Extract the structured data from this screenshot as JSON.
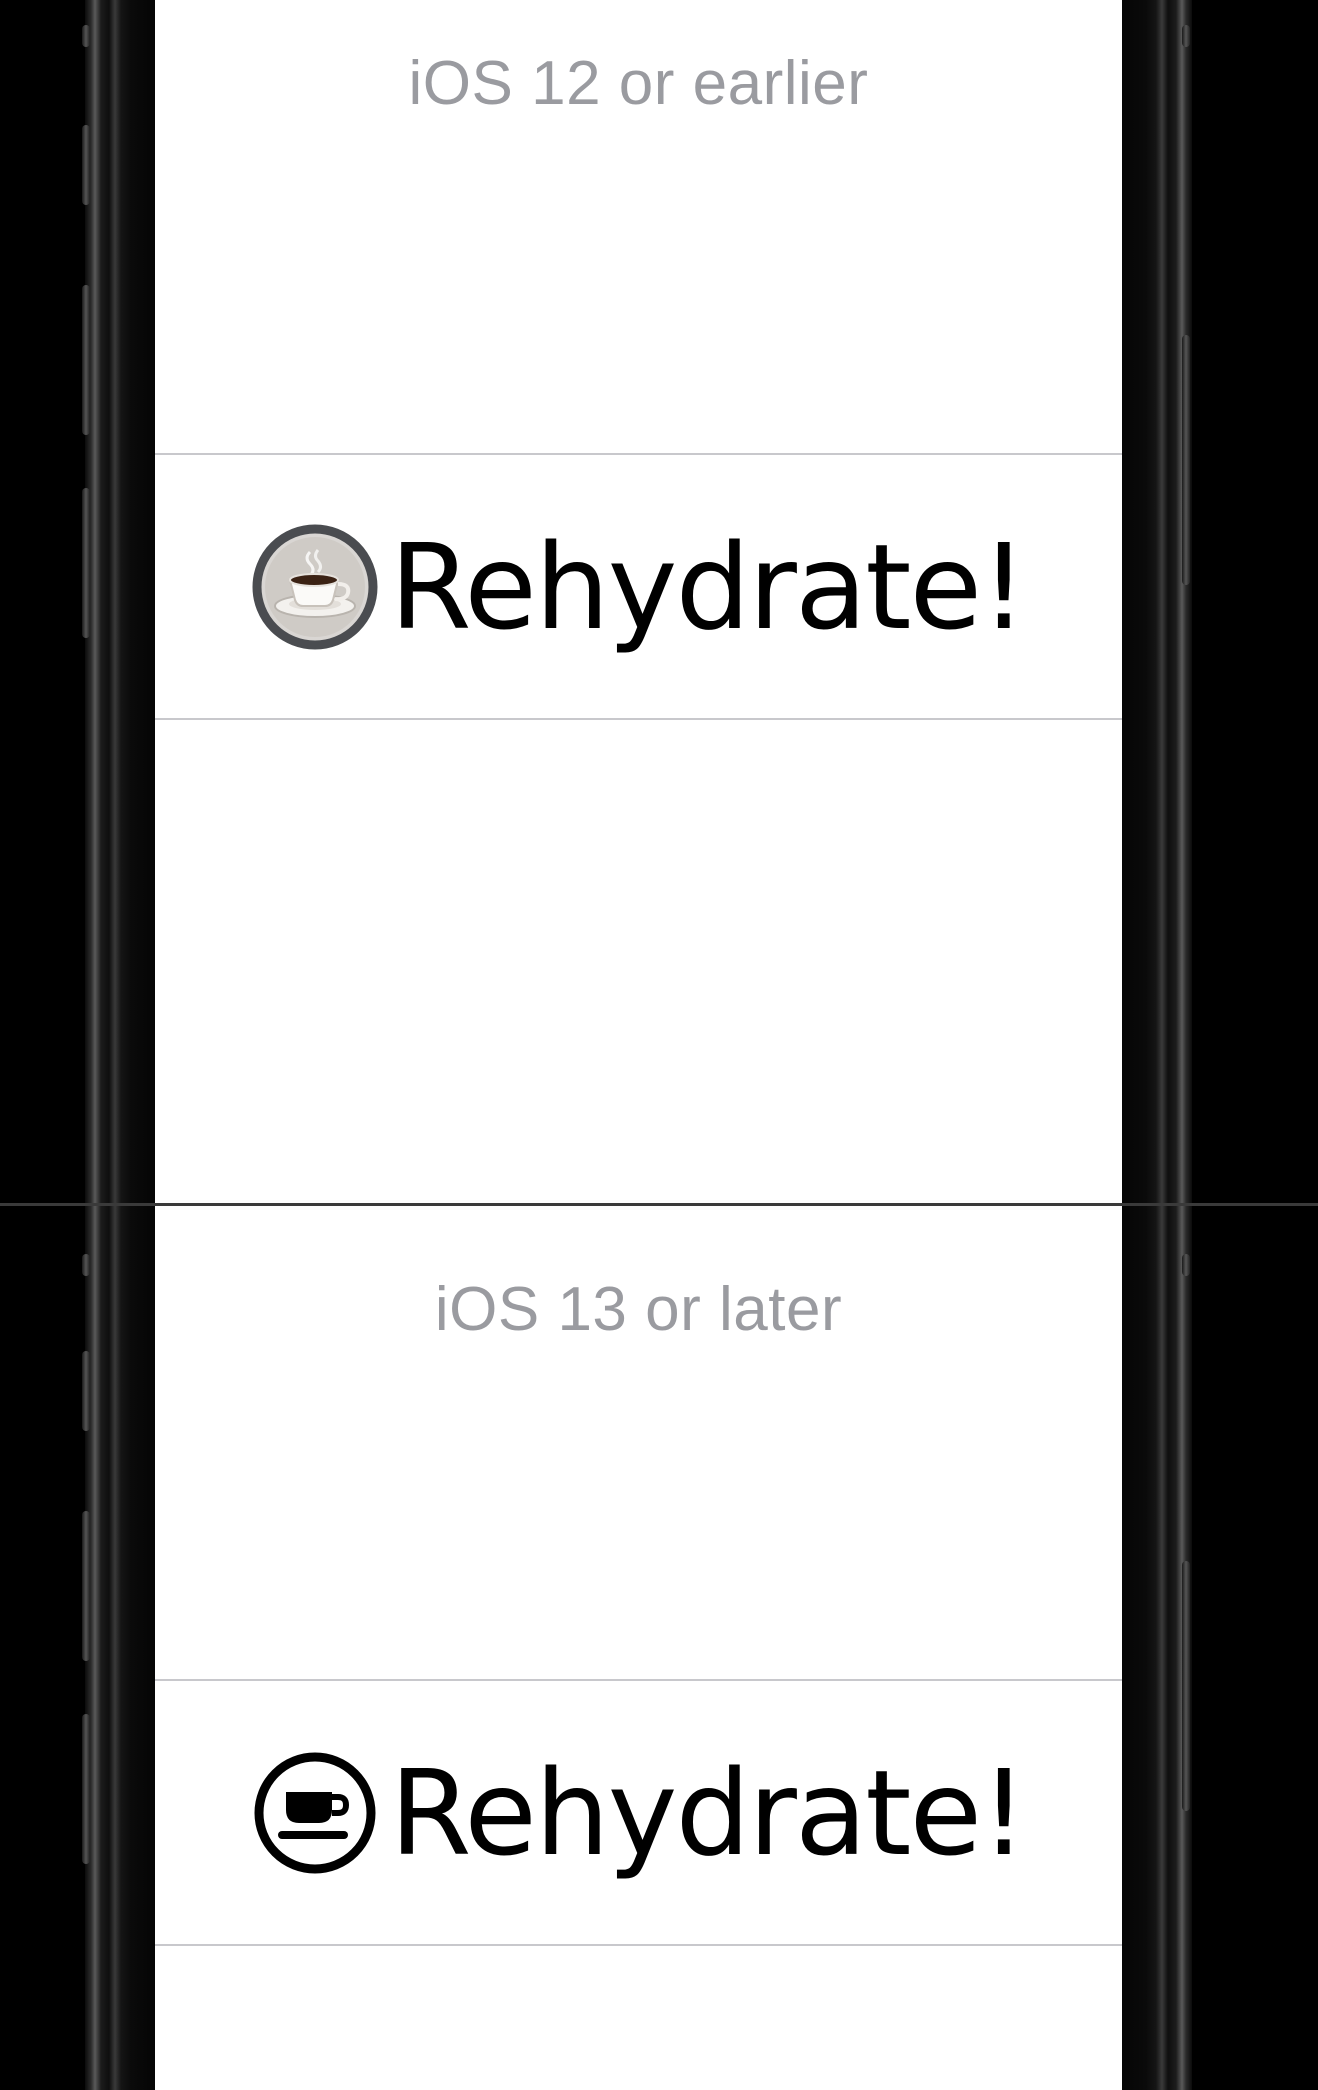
{
  "panels": {
    "legacy": {
      "version_label": "iOS 12 or earlier",
      "action": {
        "label": "Rehydrate!",
        "icon": "coffee-cup-emoji-icon"
      }
    },
    "modern": {
      "version_label": "iOS 13 or later",
      "action": {
        "label": "Rehydrate!",
        "icon": "cup-and-saucer-symbol-icon"
      }
    }
  },
  "colors": {
    "screen_background": "#ffffff",
    "version_label": "#9a9ba0",
    "divider": "#c8c8cc",
    "action_text": "#000000",
    "device_background": "#000000"
  }
}
